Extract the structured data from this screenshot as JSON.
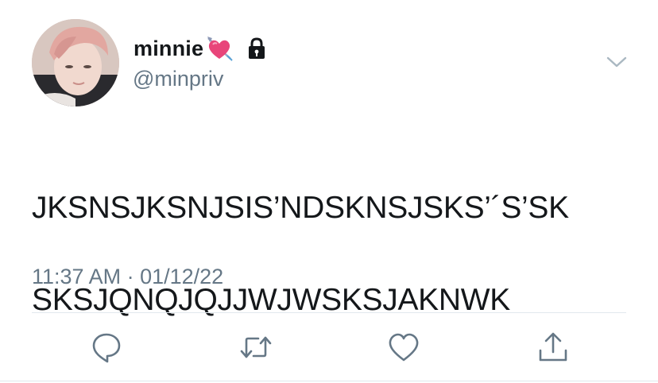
{
  "user": {
    "display_name": "minnie",
    "handle": "@minpriv",
    "name_emoji": "heart-with-arrow-icon",
    "protected_icon": "lock-icon"
  },
  "tweet": {
    "lines": [
      "JKSNSJKSNJSIS’NDSKNSJSKS’´S’SK",
      "SKSJQNQJQJJWJWSKSJAKNWK"
    ],
    "timestamp": "11:37 AM · 01/12/22"
  },
  "actions": [
    {
      "name": "reply-icon"
    },
    {
      "name": "retweet-icon"
    },
    {
      "name": "like-icon"
    },
    {
      "name": "share-icon"
    }
  ],
  "colors": {
    "text_primary": "#14171a",
    "text_secondary": "#657786",
    "icon": "#657786",
    "divider": "#e1e8ed",
    "heart": "#e8457a"
  }
}
